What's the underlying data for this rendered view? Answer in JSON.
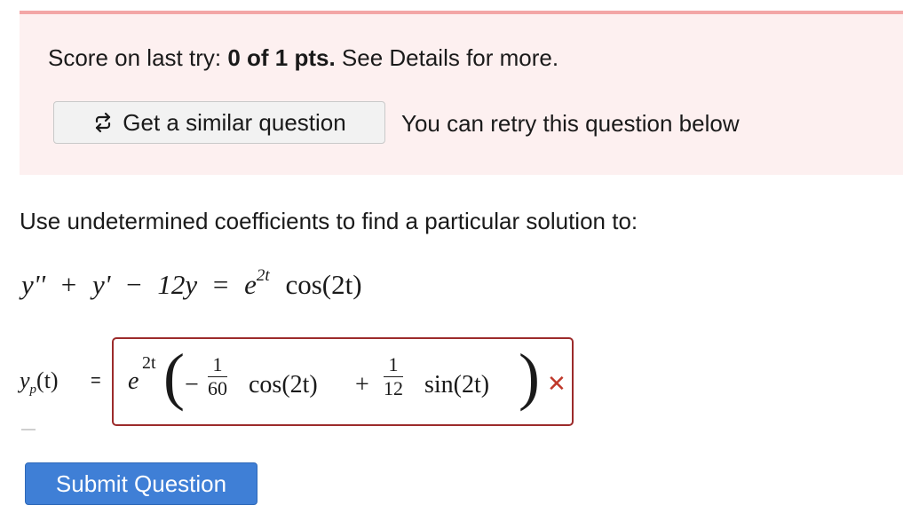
{
  "banner": {
    "score_prefix": "Score on last try:",
    "score_value": "0 of 1 pts.",
    "score_suffix": "See Details for more.",
    "similar_button_label": "Get a similar question",
    "retry_text": "You can retry this question below",
    "accent_color": "#f3a6a6",
    "background_color": "#fdf0f0"
  },
  "question": {
    "instructions": "Use undetermined coefficients to find a particular solution to:",
    "equation": {
      "lhs_1": "y''",
      "plus_1": "+",
      "lhs_2": "y'",
      "minus": "−",
      "lhs_3": "12y",
      "equals": "=",
      "rhs_base": "e",
      "rhs_exp": "2t",
      "rhs_func": "cos(2t)"
    },
    "answer_label": "y",
    "answer_label_sub": "p",
    "answer_label_arg": "(t)",
    "answer_equals": "=",
    "answer": {
      "base": "e",
      "exp": "2t",
      "open_paren": "(",
      "sign_1": "−",
      "frac_1_num": "1",
      "frac_1_den": "60",
      "func_1": "cos(2t)",
      "plus": "+",
      "frac_2_num": "1",
      "frac_2_den": "12",
      "func_2": "sin(2t)",
      "close_paren": ")"
    },
    "status": "incorrect",
    "status_icon": "x-mark-icon",
    "status_glyph": "✕",
    "status_color": "#c0392b",
    "answer_border_color": "#9c2b2b"
  },
  "actions": {
    "submit_label": "Submit Question",
    "submit_color": "#3f7fd6"
  }
}
